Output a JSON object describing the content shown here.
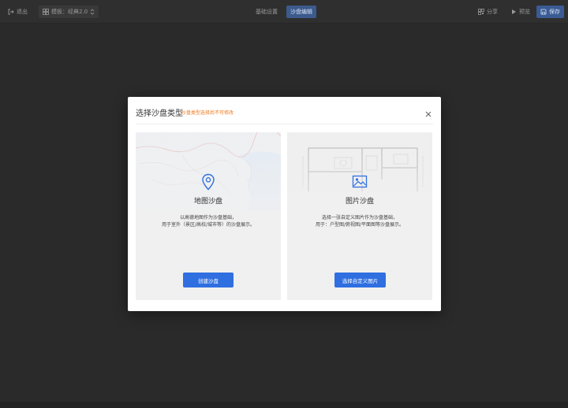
{
  "toolbar": {
    "exit_label": "退出",
    "template_label": "模板：经典2.0",
    "tabs": [
      {
        "label": "基础设置",
        "active": false
      },
      {
        "label": "沙盘编辑",
        "active": true
      }
    ],
    "share_label": "分享",
    "preview_label": "预览",
    "save_label": "保存"
  },
  "modal": {
    "title": "选择沙盘类型",
    "note": "沙盘类型选择后不可修改",
    "cards": [
      {
        "icon": "map-pin-icon",
        "title": "地图沙盘",
        "desc_line1": "以高德地图作为沙盘基础，",
        "desc_line2": "用于室外（景区/高校/城市等）的沙盘展示。",
        "button": "创建沙盘"
      },
      {
        "icon": "image-icon",
        "title": "图片沙盘",
        "desc_line1": "选择一张自定义图片作为沙盘基础，",
        "desc_line2": "用于：户型图/俯视图/平面图等沙盘展示。",
        "button": "选择自定义图片"
      }
    ]
  },
  "colors": {
    "accent": "#2f6fe0",
    "note": "#f07a1e",
    "background": "#2b2b2b"
  }
}
